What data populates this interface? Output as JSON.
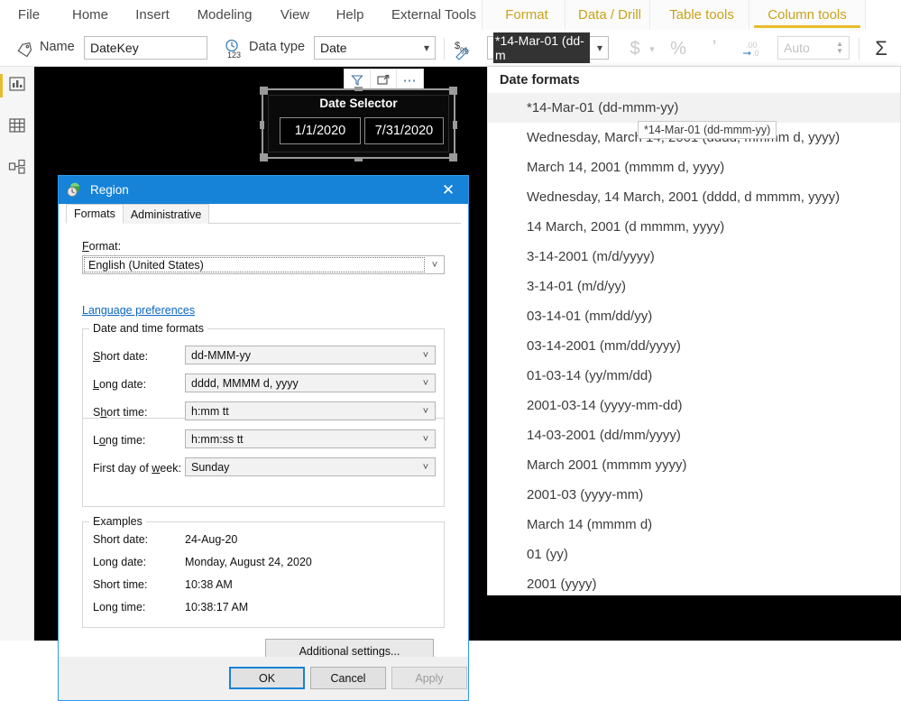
{
  "app": {
    "ribbon_tabs": [
      {
        "label": "File",
        "type": "file"
      },
      {
        "label": "Home",
        "type": "normal"
      },
      {
        "label": "Insert",
        "type": "normal"
      },
      {
        "label": "Modeling",
        "type": "normal"
      },
      {
        "label": "View",
        "type": "normal"
      },
      {
        "label": "Help",
        "type": "normal"
      },
      {
        "label": "External Tools",
        "type": "normal"
      },
      {
        "label": "Format",
        "type": "contextual"
      },
      {
        "label": "Data / Drill",
        "type": "contextual"
      },
      {
        "label": "Table tools",
        "type": "contextual"
      },
      {
        "label": "Column tools",
        "type": "contextual-active"
      }
    ],
    "accent_yellow": "#e8bb2a",
    "contextual_text": "#c8a21a"
  },
  "ribbon": {
    "name_label": "Name",
    "name_value": "DateKey",
    "data_type_label": "Data type",
    "data_type_value": "Date",
    "format_value": "*14-Mar-01 (dd-m",
    "currency_icon": "$",
    "percent_icon": "%",
    "thousands_icon": "’",
    "decimal_icon": ".00",
    "decimal_icon_sub": "→.0",
    "decimals_value": "Auto",
    "sigma_icon": "Σ",
    "format_painter_icon": "$%"
  },
  "leftnav": {
    "items": [
      {
        "name": "report-view",
        "icon": "chart-icon",
        "selected": true
      },
      {
        "name": "data-view",
        "icon": "table-icon",
        "selected": false
      },
      {
        "name": "model-view",
        "icon": "model-icon",
        "selected": false
      }
    ]
  },
  "visual": {
    "header_icons": [
      "filter-icon",
      "focus-mode-icon",
      "more-options-icon"
    ],
    "slicer_title": "Date Selector",
    "slicer_start": "1/1/2020",
    "slicer_end": "7/31/2020"
  },
  "format_dropdown": {
    "header": "Date formats",
    "selected_index": 0,
    "tooltip": "*14-Mar-01 (dd-mmm-yy)",
    "items": [
      "*14-Mar-01 (dd-mmm-yy)",
      "Wednesday, March 14, 2001 (dddd, mmmm d, yyyy)",
      "March 14, 2001 (mmmm d, yyyy)",
      "Wednesday, 14 March, 2001 (dddd, d mmmm, yyyy)",
      "14 March, 2001 (d mmmm, yyyy)",
      "3-14-2001 (m/d/yyyy)",
      "3-14-01 (m/d/yy)",
      "03-14-01 (mm/dd/yy)",
      "03-14-2001 (mm/dd/yyyy)",
      "01-03-14 (yy/mm/dd)",
      "2001-03-14 (yyyy-mm-dd)",
      "14-03-2001 (dd/mm/yyyy)",
      "March 2001 (mmmm yyyy)",
      "2001-03 (yyyy-mm)",
      "March 14 (mmmm d)",
      "01 (yy)",
      "2001 (yyyy)"
    ]
  },
  "region_dialog": {
    "title": "Region",
    "close_label": "✕",
    "tabs": [
      {
        "label": "Formats",
        "active": true
      },
      {
        "label": "Administrative",
        "active": false
      }
    ],
    "format_label": "Format:",
    "format_value": "English (United States)",
    "language_link": "Language preferences",
    "datetime_group_title": "Date and time formats",
    "fields": [
      {
        "label": "Short date:",
        "value": "dd-MMM-yy"
      },
      {
        "label": "Long date:",
        "value": "dddd, MMMM d, yyyy"
      },
      {
        "label": "Short time:",
        "value": "h:mm tt"
      },
      {
        "label": "Long time:",
        "value": "h:mm:ss tt"
      },
      {
        "label": "First day of week:",
        "value": "Sunday"
      }
    ],
    "examples_group_title": "Examples",
    "examples": [
      {
        "label": "Short date:",
        "value": "24-Aug-20"
      },
      {
        "label": "Long date:",
        "value": "Monday, August 24, 2020"
      },
      {
        "label": "Short time:",
        "value": "10:38 AM"
      },
      {
        "label": "Long time:",
        "value": "10:38:17 AM"
      }
    ],
    "additional_settings": "Additional settings...",
    "ok": "OK",
    "cancel": "Cancel",
    "apply": "Apply"
  }
}
